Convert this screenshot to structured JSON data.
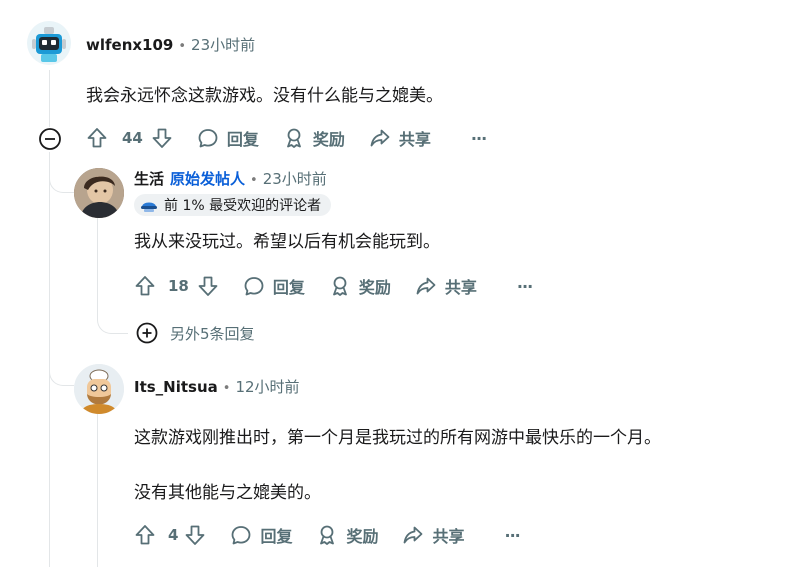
{
  "comments": [
    {
      "username": "wlfenx109",
      "time": "23小时前",
      "text": "我会永远怀念这款游戏。没有什么能与之媲美。",
      "votes": "44",
      "reply": "回复",
      "award": "奖励",
      "share": "共享",
      "more": "···"
    },
    {
      "username": "生活",
      "op_label": "原始发帖人",
      "time": "23小时前",
      "badge": "前 1% 最受欢迎的评论者",
      "text": "我从来没玩过。希望以后有机会能玩到。",
      "votes": "18",
      "reply": "回复",
      "award": "奖励",
      "share": "共享",
      "more": "···"
    },
    {
      "username": "Its_Nitsua",
      "time": "12小时前",
      "text_lines": [
        "这款游戏刚推出时，第一个月是我玩过的所有网游中最快乐的一个月。",
        "没有其他能与之媲美的。"
      ],
      "votes": "4",
      "reply": "回复",
      "award": "奖励",
      "share": "共享",
      "more": "···"
    }
  ],
  "more_replies": "另外5条回复",
  "colors": {
    "op": "#0a5fd8",
    "muted": "#576f76",
    "line": "#e3e6e8"
  },
  "dot": "•"
}
